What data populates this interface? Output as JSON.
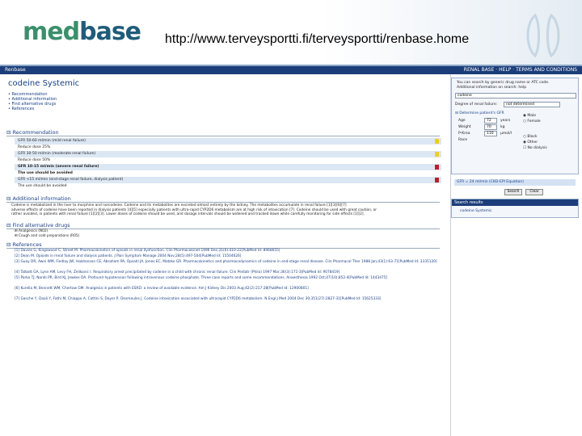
{
  "slide": {
    "logo_part1": "med",
    "logo_part2": "base",
    "url": "http://www.terveysportti.fi/terveysportti/renbase.home"
  },
  "app": {
    "brand": "Renbase",
    "nav_links": "RENAL BASE · HELP · TERMS AND CONDITIONS"
  },
  "page": {
    "title": "codeine Systemic",
    "toc": [
      "Recommendation",
      "Additional information",
      "Find alternative drugs",
      "References"
    ]
  },
  "recommendation": {
    "heading": "Recommendation",
    "rows": [
      {
        "text": "GFR 50-60 ml/min (mild renal failure)",
        "shade": true,
        "strong": false,
        "mark": "yellow"
      },
      {
        "text": "Reduce dose 25%",
        "shade": false,
        "strong": false,
        "mark": ""
      },
      {
        "text": "GFR 30-50 ml/min (moderate renal failure)",
        "shade": true,
        "strong": false,
        "mark": "yellow"
      },
      {
        "text": "Reduce dose 50%",
        "shade": false,
        "strong": false,
        "mark": ""
      },
      {
        "text": "GFR 10-15 ml/min (severe renal failure)",
        "shade": true,
        "strong": true,
        "mark": "red"
      },
      {
        "text": "The use should be avoided",
        "shade": false,
        "strong": true,
        "mark": ""
      },
      {
        "text": "GFR <15 ml/min (end-stage renal failure, dialysis patient)",
        "shade": true,
        "strong": false,
        "mark": "red"
      },
      {
        "text": "The use should be avoided",
        "shade": false,
        "strong": false,
        "mark": ""
      }
    ]
  },
  "additional": {
    "heading": "Additional information",
    "lines": [
      "Codeine is metabolized in the liver to morphine and norcodeine. Codeine and its metabolites are excreted almost entirely by the kidney. The metabolites accumulate in renal failure [1][3][6][7]",
      "adverse effects of codeine have been reported in dialysis patients [4][5] especially patients with ultra-rapid CYP2D6 metabolism are at high risk of intoxication [7]. Codeine should be used with great caution, or",
      "rather avoided, in patients with renal failure [1][2][3]. Lower doses of codeine should be used, and dosage intervals should be widened and tracked down while carefully monitoring for side effects [1][2]."
    ]
  },
  "alternatives": {
    "heading": "Find alternative drugs",
    "items": [
      "Analgesics (N02)",
      "Cough and cold preparations (R05)"
    ]
  },
  "references": {
    "heading": "References",
    "items": [
      "[1] Davies G, Kingswood C, Street M. Pharmacokinetics of opioids in renal dysfunction. Clin Pharmacokinet 1996 Dec;31(6):410-22[PubMed Id: 8968655]",
      "[2] Dean M. Opioids in renal failure and dialysis patients. J Pain Symptom Manage 2004 Nov;28(5):497-504[PubMed Id: 15504626]",
      "[3] Guay DR, Awni WM, Findlay JW, Halstenson CE, Abraham PA, Opsahl JA, Jones EC, Matzke GR. Pharmacokinetics and pharmacodynamics of codeine in end-stage renal disease. Clin Pharmacol Ther 1988 Jan;43(1):63-71[PubMed Id: 3335120]",
      "[4] Talbott GA, Lynn AM, Levy FH, Zelikovic I. Respiratory arrest precipitated by codeine in a child with chronic renal failure. Clin Pediatr (Phila) 1997 Mar;36(3):171-3[PubMed Id: 9078419]",
      "[5] Parke TJ, Nandi PR, Bird KJ, Jewkes DA. Profound hypotension following intravenous codeine phosphate. Three case reports and some recommendations. Anaesthesia 1992 Oct;47(10):852-4[PubMed Id: 1443475]",
      "[6] Kurella M, Bennett WM, Chertow GM. Analgesia in patients with ESRD: a review of available evidence. Am J Kidney Dis 2003 Aug;42(2):217-28[PubMed Id: 12900801]",
      "[7] Gasche Y, Daali Y, Fathi M, Chiappe A, Cottini S, Dayer P, Desmeules J. Codeine intoxication associated with ultrarapid CYP2D6 metabolism. N Engl J Med 2004 Dec 30;351(27):2827-31[PubMed Id: 15625333]"
    ]
  },
  "search": {
    "intro": "You can search by generic drug name or ATC code.",
    "intro2": "Additional information on search: help",
    "query": "codeine",
    "degree_label": "Degree of renal failure:",
    "degree_value": "not determined",
    "determine_label": "Determine patient's GFR",
    "age_label": "Age",
    "age_value": "72",
    "age_unit": "years",
    "weight_label": "Weight",
    "weight_value": "70",
    "weight_unit": "kg",
    "creat_label": "P-Krea",
    "creat_value": "110",
    "creat_unit": "µmol/l",
    "race_label": "Race",
    "sex_options": [
      "Male",
      "Female"
    ],
    "race_options": [
      "Black",
      "Other"
    ],
    "dialysis_label": "No dialysis",
    "gfr_result": "GFR = 24 ml/min (CKD-EPI Equation)",
    "search_button": "Search",
    "clear_button": "Clear",
    "results_heading": "Search results",
    "result_item": "codeine Systemic"
  },
  "colors": {
    "brand_green": "#3b8f6b",
    "brand_blue": "#1f5c7a",
    "header_navy": "#1b3d79",
    "mark_yellow": "#e9d11c",
    "mark_red": "#b8202a"
  }
}
